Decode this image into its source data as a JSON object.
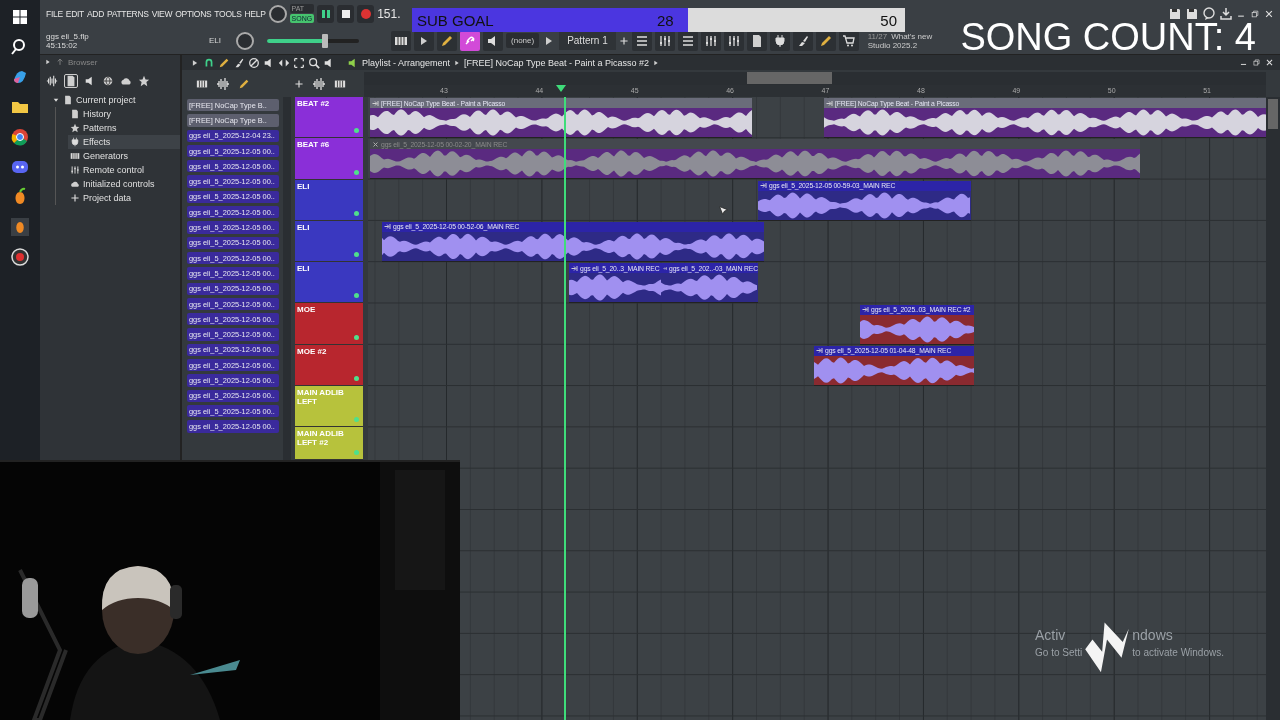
{
  "menu": [
    "FILE",
    "EDIT",
    "ADD",
    "PATTERNS",
    "VIEW",
    "OPTIONS",
    "TOOLS",
    "HELP"
  ],
  "project": {
    "file": "ggs eli_5.flp",
    "time": "45:15:02",
    "channel": "ELI"
  },
  "transport": {
    "modes": [
      {
        "label": "PAT",
        "selected": false
      },
      {
        "label": "SONG",
        "selected": true
      }
    ],
    "tempo": "151.",
    "master": {
      "level": 0.63
    }
  },
  "toolbar": {
    "snap": "(none)",
    "pattern": "Pattern 1",
    "news_date": "11/27",
    "news_title": "What's new",
    "news_version": "Studio 2025.2"
  },
  "sub_goal": {
    "label": "SUB GOAL",
    "current": "28",
    "target": "50",
    "level": 0.56
  },
  "song_count": "SONG COUNT: 4",
  "browser": {
    "title": "Browser",
    "items": [
      {
        "label": "Current project",
        "selected": false,
        "expanded": true,
        "children": [
          {
            "label": "History",
            "selected": false
          },
          {
            "label": "Patterns",
            "selected": false
          },
          {
            "label": "Effects",
            "selected": true
          },
          {
            "label": "Generators",
            "selected": false
          },
          {
            "label": "Remote control",
            "selected": false
          },
          {
            "label": "Initialized controls",
            "selected": false
          },
          {
            "label": "Project data",
            "selected": false
          }
        ]
      }
    ]
  },
  "playlist": {
    "title": "Playlist - Arrangement",
    "arrangement": "[FREE] NoCap Type Beat - Paint a Picasso #2",
    "ruler": [
      "43",
      "44",
      "45",
      "46",
      "47",
      "48",
      "49",
      "50",
      "51"
    ],
    "clip_sources": [
      {
        "label": "[FREE] NoCap Type B..",
        "color": "#5d5f6e"
      },
      {
        "label": "[FREE] NoCap Type B..",
        "color": "#5d5f6e"
      },
      {
        "label": "ggs eli_5_2025-12-04 23..",
        "color": "#3a2a9c"
      },
      {
        "label": "ggs eli_5_2025-12-05 00..",
        "color": "#3a2a9c"
      },
      {
        "label": "ggs eli_5_2025-12-05 00..",
        "color": "#3a2a9c"
      },
      {
        "label": "ggs eli_5_2025-12-05 00..",
        "color": "#3a2a9c"
      },
      {
        "label": "ggs eli_5_2025-12-05 00..",
        "color": "#3a2a9c"
      },
      {
        "label": "ggs eli_5_2025-12-05 00..",
        "color": "#3a2a9c"
      },
      {
        "label": "ggs eli_5_2025-12-05 00..",
        "color": "#3a2a9c"
      },
      {
        "label": "ggs eli_5_2025-12-05 00..",
        "color": "#3a2a9c"
      },
      {
        "label": "ggs eli_5_2025-12-05 00..",
        "color": "#3a2a9c"
      },
      {
        "label": "ggs eli_5_2025-12-05 00..",
        "color": "#3a2a9c"
      },
      {
        "label": "ggs eli_5_2025-12-05 00..",
        "color": "#3a2a9c"
      },
      {
        "label": "ggs eli_5_2025-12-05 00..",
        "color": "#3a2a9c"
      },
      {
        "label": "ggs eli_5_2025-12-05 00..",
        "color": "#3a2a9c"
      },
      {
        "label": "ggs eli_5_2025-12-05 00..",
        "color": "#3a2a9c"
      },
      {
        "label": "ggs eli_5_2025-12-05 00..",
        "color": "#3a2a9c"
      },
      {
        "label": "ggs eli_5_2025-12-05 00..",
        "color": "#3a2a9c"
      },
      {
        "label": "ggs eli_5_2025-12-05 00..",
        "color": "#3a2a9c"
      },
      {
        "label": "ggs eli_5_2025-12-05 00..",
        "color": "#3a2a9c"
      },
      {
        "label": "ggs eli_5_2025-12-05 00..",
        "color": "#3a2a9c"
      },
      {
        "label": "ggs eli_5_2025-12-05 00..",
        "color": "#3a2a9c"
      }
    ],
    "tracks": [
      {
        "name": "BEAT #2",
        "color": "#8a2fd8",
        "clips": [
          {
            "title": "[FREE] NoCap Type Beat - Paint a Picasso",
            "muted": false
          },
          {
            "title": "[FREE] NoCap Type Beat - Paint a Picasso",
            "muted": false
          }
        ]
      },
      {
        "name": "BEAT #6",
        "color": "#8a2fd8",
        "clips": [
          {
            "title": "ggs eli_5_2025-12-05 00-02-20_MAIN REC",
            "muted": true
          }
        ]
      },
      {
        "name": "ELI",
        "color": "#3a38c0",
        "clips": [
          {
            "title": "ggs eli_5_2025-12-05 00-59-03_MAIN REC",
            "muted": false
          }
        ]
      },
      {
        "name": "ELI",
        "color": "#3a38c0",
        "clips": [
          {
            "title": "ggs eli_5_2025-12-05 00-52-06_MAIN REC",
            "muted": false
          }
        ]
      },
      {
        "name": "ELI",
        "color": "#3a38c0",
        "clips": [
          {
            "title": "ggs eli_5_20..3_MAIN REC",
            "muted": false
          },
          {
            "title": "ggs eli_5_202..-03_MAIN REC",
            "muted": false
          }
        ]
      },
      {
        "name": "MOE",
        "color": "#b8262e",
        "clips": [
          {
            "title": "ggs eli_5_2025..03_MAIN REC #2",
            "muted": false
          }
        ]
      },
      {
        "name": "MOE #2",
        "color": "#b8262e",
        "clips": [
          {
            "title": "ggs eli_5_2025-12-05 01-04-48_MAIN REC",
            "muted": false
          }
        ]
      },
      {
        "name": "MAIN ADLIB LEFT",
        "color": "#b7c23c"
      },
      {
        "name": "MAIN ADLIB LEFT #2",
        "color": "#b7c23c"
      }
    ]
  },
  "activation": {
    "title_parts": [
      "Activ",
      "ndows"
    ],
    "hint_parts": [
      "Go to Setti",
      "to activate Windows."
    ]
  }
}
